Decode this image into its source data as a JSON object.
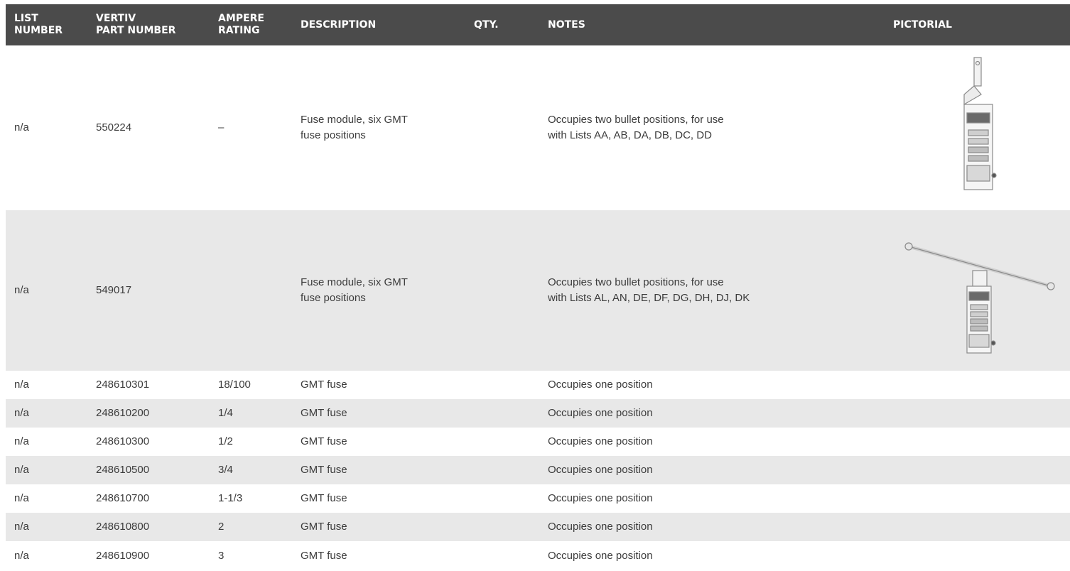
{
  "headers": {
    "list_number": [
      "LIST",
      "NUMBER"
    ],
    "part_number": [
      "VERTIV",
      "PART NUMBER"
    ],
    "ampere_rating": [
      "AMPERE",
      "RATING"
    ],
    "description": "DESCRIPTION",
    "qty": "QTY.",
    "notes": "NOTES",
    "pictorial": "PICTORIAL"
  },
  "rows": [
    {
      "list": "n/a",
      "part": "550224",
      "amp": "–",
      "desc": [
        "Fuse module, six GMT",
        "fuse positions"
      ],
      "qty": "",
      "notes": [
        "Occupies two bullet positions, for use",
        "with Lists AA, AB, DA, DB, DC, DD"
      ],
      "pictorial": "fuse-module-vertical-image"
    },
    {
      "list": "n/a",
      "part": "549017",
      "amp": "",
      "desc": [
        "Fuse module, six GMT",
        "fuse positions"
      ],
      "qty": "",
      "notes": [
        "Occupies two bullet positions, for use",
        "with Lists  AL, AN, DE, DF, DG, DH, DJ, DK"
      ],
      "pictorial": "fuse-module-with-bar-image"
    },
    {
      "list": "n/a",
      "part": "248610301",
      "amp": "18/100",
      "desc": "GMT fuse",
      "qty": "",
      "notes": "Occupies one position"
    },
    {
      "list": "n/a",
      "part": "248610200",
      "amp": "1/4",
      "desc": "GMT fuse",
      "qty": "",
      "notes": "Occupies one position"
    },
    {
      "list": "n/a",
      "part": "248610300",
      "amp": "1/2",
      "desc": "GMT fuse",
      "qty": "",
      "notes": "Occupies one position"
    },
    {
      "list": "n/a",
      "part": "248610500",
      "amp": "3/4",
      "desc": "GMT fuse",
      "qty": "",
      "notes": "Occupies one position"
    },
    {
      "list": "n/a",
      "part": "248610700",
      "amp": "1-1/3",
      "desc": "GMT fuse",
      "qty": "",
      "notes": "Occupies one position"
    },
    {
      "list": "n/a",
      "part": "248610800",
      "amp": "2",
      "desc": "GMT fuse",
      "qty": "",
      "notes": "Occupies one position"
    },
    {
      "list": "n/a",
      "part": "248610900",
      "amp": "3",
      "desc": "GMT fuse",
      "qty": "",
      "notes": "Occupies one position"
    }
  ]
}
